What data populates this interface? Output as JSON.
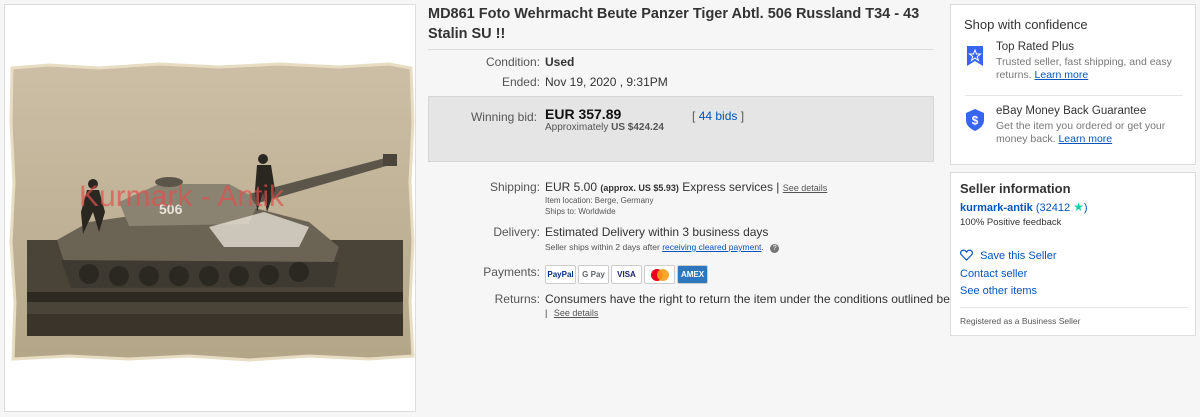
{
  "listing": {
    "title": "MD861 Foto Wehrmacht Beute Panzer Tiger Abtl. 506 Russland T34 - 43 Stalin SU !!",
    "photo_watermark": "Kurmark - Antik",
    "tank_marking": "506",
    "condition_label": "Condition:",
    "condition_value": "Used",
    "ended_label": "Ended:",
    "ended_value": "Nov 19, 2020 , 9:31PM",
    "winning_bid_label": "Winning bid:",
    "winning_bid_price": "EUR 357.89",
    "approx_prefix": "Approximately",
    "approx_value": "US $424.24",
    "bids_text": "44 bids",
    "bids_open": "[",
    "bids_close": "]",
    "shipping_label": "Shipping:",
    "shipping_price": "EUR 5.00",
    "shipping_approx": "(approx. US $5.93)",
    "shipping_service": "Express services |",
    "shipping_details": "See details",
    "item_location": "Item location:  Berge, Germany",
    "ships_to": "Ships to:  Worldwide",
    "delivery_label": "Delivery:",
    "delivery_value": "Estimated Delivery within 3 business days",
    "delivery_note_prefix": "Seller ships within 2 days after",
    "delivery_note_link": "receiving cleared payment",
    "delivery_note_suffix": ".",
    "payments_label": "Payments:",
    "returns_label": "Returns:",
    "returns_value": "Consumers have the right to return the item under the conditions outlined below",
    "returns_pipe": "|",
    "returns_details": "See details"
  },
  "payments": [
    {
      "name": "paypal-icon",
      "text": "PayPal",
      "color": "#003087",
      "bg": "#ffffff"
    },
    {
      "name": "google-pay-icon",
      "text": "G Pay",
      "color": "#5f6368",
      "bg": "#ffffff"
    },
    {
      "name": "visa-icon",
      "text": "VISA",
      "color": "#1a1f71",
      "bg": "#ffffff"
    },
    {
      "name": "mastercard-icon",
      "text": "",
      "color": "#eb001b",
      "bg": "#ffffff"
    },
    {
      "name": "amex-icon",
      "text": "AMEX",
      "color": "#ffffff",
      "bg": "#2e77bc"
    }
  ],
  "confidence": {
    "title": "Shop with confidence",
    "top_rated_title": "Top Rated Plus",
    "top_rated_text": "Trusted seller, fast shipping, and easy returns.",
    "top_rated_link": "Learn more",
    "guarantee_title": "eBay Money Back Guarantee",
    "guarantee_text": "Get the item you ordered or get your money back.",
    "guarantee_link": "Learn more"
  },
  "seller": {
    "title": "Seller information",
    "name": "kurmark-antik",
    "score": "(32412",
    "score_close": ")",
    "feedback": "100% Positive feedback",
    "save": "Save this Seller",
    "contact": "Contact seller",
    "other": "See other items",
    "registered": "Registered as a Business Seller"
  },
  "colors": {
    "link": "#0654ba",
    "badge": "#3665f3",
    "star": "#1dcbab"
  }
}
